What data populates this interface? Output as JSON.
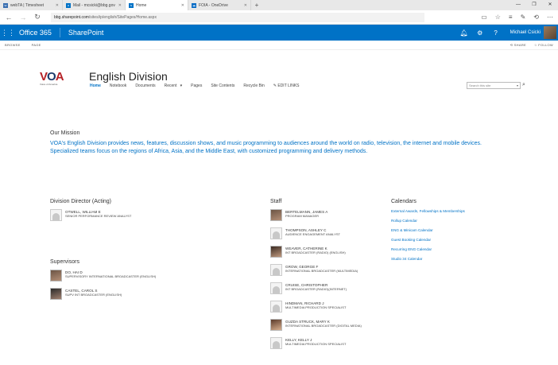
{
  "browser": {
    "tabs": [
      {
        "label": "webTA | Timesheet",
        "icon_color": "#3a6fb0",
        "active": false
      },
      {
        "label": "Mail - mcsicki@bbg.gov",
        "icon_color": "#0072c6",
        "active": false
      },
      {
        "label": "Home",
        "icon_color": "#0072c6",
        "active": true
      },
      {
        "label": "FOIA - OneDrive",
        "icon_color": "#0f6fc6",
        "active": false
      }
    ],
    "url_host": "bbg.sharepoint.com",
    "url_path": "/sites/ip/english/SitePages/Home.aspx"
  },
  "suitebar": {
    "brand": "Office 365",
    "app": "SharePoint",
    "user": "Michael Csicki",
    "color": "#0072c6"
  },
  "ribbon": {
    "browse": "BROWSE",
    "page": "PAGE",
    "share": "SHARE",
    "follow": "FOLLOW"
  },
  "site": {
    "logo_text": "Voice of America",
    "title": "English Division",
    "nav": [
      "Home",
      "Notebook",
      "Documents",
      "Recent",
      "Pages",
      "Site Contents",
      "Recycle Bin"
    ],
    "edit_links": "EDIT LINKS",
    "search_placeholder": "Search this site"
  },
  "mission": {
    "heading": "Our Mission",
    "text": "VOA's English Division provides news, features, discussion shows, and music programming to audiences around the world on radio, television, the internet and mobile devices. Specialized teams focus on the regions of Africa, Asia, and the Middle East, with customized programming and delivery methods."
  },
  "director": {
    "heading": "Division Director (Acting)",
    "people": [
      {
        "name": "OTWELL, WILLIAM E",
        "title": "SENIOR PERFORMANCE REVIEW ANALYST",
        "photo": false
      }
    ]
  },
  "supervisors": {
    "heading": "Supervisors",
    "people": [
      {
        "name": "DO, HAI D",
        "title": "SUPERVISORY INTERNATIONAL BROADCASTER (ENGLISH)",
        "photo": true
      },
      {
        "name": "CASTEL, CAROL S",
        "title": "SUPV INT BROADCASTER (ENGLISH)",
        "photo": true
      }
    ]
  },
  "staff": {
    "heading": "Staff",
    "people": [
      {
        "name": "BERTELMANN, JAMES A",
        "title": "PROGRAM MANAGER",
        "photo": true
      },
      {
        "name": "THOMPSON, ASHLEY C",
        "title": "AUDIENCE ENGAGEMENT ANALYST",
        "photo": false
      },
      {
        "name": "WEAVER, CATHERINE K",
        "title": "INT BROADCASTER (RADIO) (ENGLISH)",
        "photo": true
      },
      {
        "name": "GROW, GEORGE F",
        "title": "INTERNATIONAL BROADCASTER (MULTIMEDIA)",
        "photo": false
      },
      {
        "name": "CRUISE, CHRISTOPHER",
        "title": "INT BROADCASTER (RADIO)(INTERNET)",
        "photo": false
      },
      {
        "name": "HINDMAN, RICHARD J",
        "title": "MULTIMEDIA PRODUCTION SPECIALIST",
        "photo": false
      },
      {
        "name": "GUZDA STRUCK, MARY K",
        "title": "INTERNATIONAL BROADCASTER (DIGITAL MEDIA)",
        "photo": true
      },
      {
        "name": "KELLY, KELLY J",
        "title": "MULTIMEDIA PRODUCTION SPECIALIST",
        "photo": false
      }
    ]
  },
  "calendars": {
    "heading": "Calendars",
    "items": [
      "External Awards, Fellowships & Memberships",
      "Rollup Calendar",
      "ENG & Minicam Calendar",
      "Guest Booking Calendar",
      "Recurring ENG Calendar",
      "Studio 34 Calendar"
    ]
  }
}
